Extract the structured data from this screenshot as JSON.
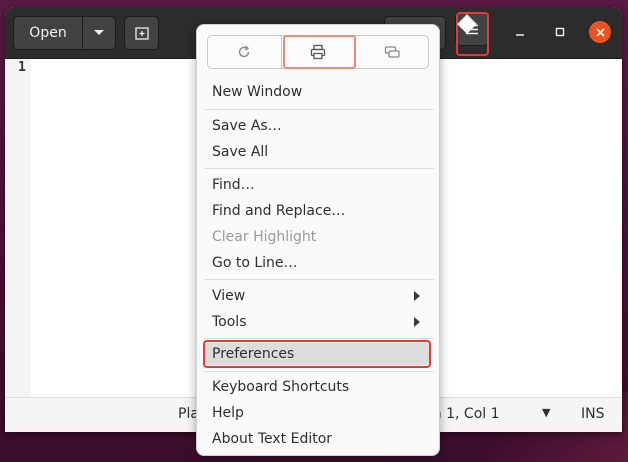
{
  "headerbar": {
    "open_label": "Open",
    "icons": [
      "chevron-down-icon",
      "new-tab-icon",
      "hamburger-menu-icon",
      "minimize-icon",
      "maximize-icon",
      "close-icon"
    ]
  },
  "editor": {
    "line_number": "1"
  },
  "statusbar": {
    "language": "Pla",
    "position": "Ln 1, Col 1",
    "mode": "INS"
  },
  "menu": {
    "icon_buttons": [
      "reload-icon",
      "print-icon",
      "fullscreen-icon"
    ],
    "items": [
      {
        "label": "New Window"
      },
      {
        "label": "Save As…"
      },
      {
        "label": "Save All"
      },
      {
        "label": "Find…"
      },
      {
        "label": "Find and Replace…"
      },
      {
        "label": "Clear Highlight"
      },
      {
        "label": "Go to Line…"
      },
      {
        "label": "View"
      },
      {
        "label": "Tools"
      },
      {
        "label": "Preferences"
      },
      {
        "label": "Keyboard Shortcuts"
      },
      {
        "label": "Help"
      },
      {
        "label": "About Text Editor"
      }
    ]
  },
  "colors": {
    "close_button": "#e95420",
    "highlight_box": "#e23a3a"
  }
}
